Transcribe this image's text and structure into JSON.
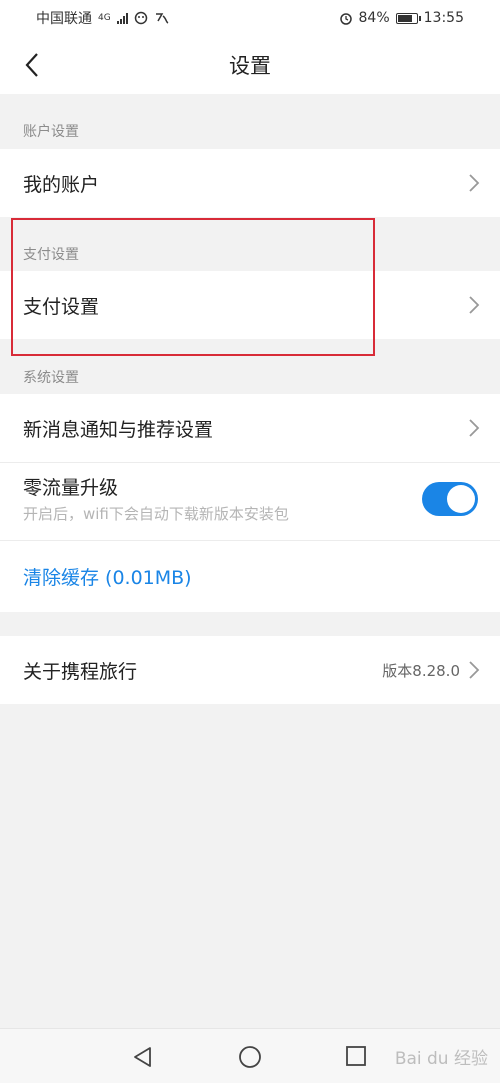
{
  "status_bar": {
    "carrier": "中国联通",
    "network_type": "4G",
    "battery_percent": "84%",
    "time": "13:55",
    "battery_level": 0.84
  },
  "header": {
    "title": "设置"
  },
  "account_section": {
    "label": "账户设置",
    "items": [
      {
        "label": "我的账户"
      }
    ]
  },
  "payment_section": {
    "label": "支付设置",
    "items": [
      {
        "label": "支付设置"
      }
    ]
  },
  "system_section": {
    "label": "系统设置",
    "notifications_label": "新消息通知与推荐设置",
    "zero_traffic_label": "零流量升级",
    "zero_traffic_desc": "开启后，wifi下会自动下载新版本安装包",
    "zero_traffic_enabled": true,
    "clear_cache_label": "清除缓存 (0.01MB)"
  },
  "about": {
    "label": "关于携程旅行",
    "version": "版本8.28.0"
  },
  "watermark": "Bai du 经验",
  "colors": {
    "accent": "#1a85e6",
    "highlight_border": "#d82b38",
    "background": "#f2f2f2"
  }
}
